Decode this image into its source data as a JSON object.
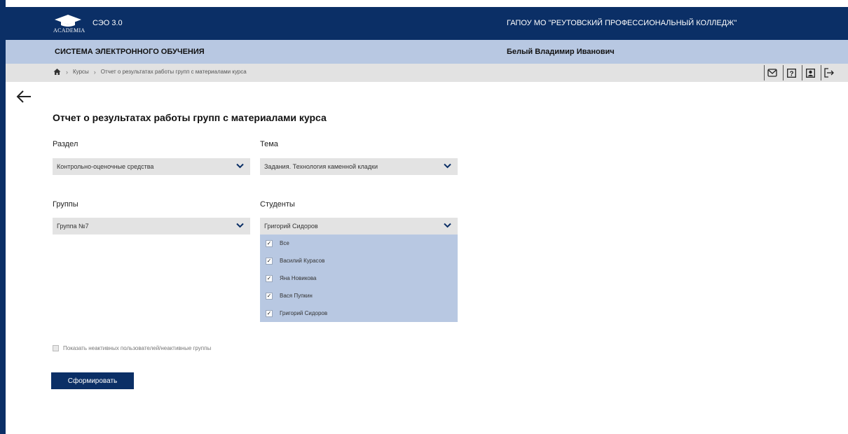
{
  "header": {
    "logo_text": "ACADEMIA",
    "app_name": "СЭО 3.0",
    "org_name": "ГАПОУ МО \"РЕУТОВСКИЙ ПРОФЕССИОНАЛЬНЫЙ КОЛЛЕДЖ\""
  },
  "subheader": {
    "system_title": "СИСТЕМА ЭЛЕКТРОННОГО ОБУЧЕНИЯ",
    "user_name": "Белый Владимир Иванович"
  },
  "breadcrumb": {
    "items": [
      "Курсы",
      "Отчет о результатах работы групп с материалами курса"
    ]
  },
  "toolbar": {
    "icons": [
      "mail-icon",
      "help-icon",
      "profile-icon",
      "logout-icon"
    ]
  },
  "main": {
    "title": "Отчет о результатах работы групп с материалами курса",
    "section": {
      "label": "Раздел",
      "value": "Контрольно-оценочные средства"
    },
    "topic": {
      "label": "Тема",
      "value": "Задания. Технология каменной кладки"
    },
    "groups": {
      "label": "Группы",
      "value": "Группа №7"
    },
    "students": {
      "label": "Студенты",
      "value": "Григорий Сидоров",
      "options": [
        {
          "label": "Все",
          "checked": true
        },
        {
          "label": "Василий Курасов",
          "checked": true
        },
        {
          "label": "Яна Новикова",
          "checked": true
        },
        {
          "label": "Вася Пупкин",
          "checked": true
        },
        {
          "label": "Григорий Сидоров",
          "checked": true
        }
      ]
    },
    "inactive_toggle": {
      "label": "Показать неактивных пользователей/неактивные группы",
      "checked": false
    },
    "submit_label": "Сформировать"
  },
  "colors": {
    "brand_dark": "#0b2f66",
    "brand_light": "#b8c8e2",
    "breadcrumb_bg": "#e2e2e2",
    "select_bg": "#e3e3e3"
  }
}
